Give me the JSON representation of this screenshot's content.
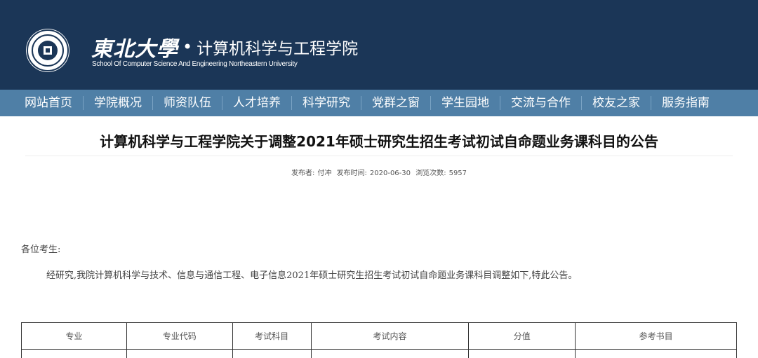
{
  "header": {
    "university": "東北大學",
    "separator": "•",
    "school_cn": "计算机科学与工程学院",
    "school_en": "School Of Computer Science And Engineering Northeastern University"
  },
  "nav": {
    "items": [
      "网站首页",
      "学院概况",
      "师资队伍",
      "人才培养",
      "科学研究",
      "党群之窗",
      "学生园地",
      "交流与合作",
      "校友之家",
      "服务指南"
    ]
  },
  "article": {
    "title": "计算机科学与工程学院关于调整2021年硕士研究生招生考试初试自命题业务课科目的公告",
    "meta": {
      "author_label": "发布者:",
      "author": "付冲",
      "date_label": "发布时间:",
      "date": "2020-06-30",
      "views_label": "浏览次数:",
      "views": "5957"
    },
    "greeting": "各位考生:",
    "paragraph": "经研究,我院计算机科学与技术、信息与通信工程、电子信息2021年硕士研究生招生考试初试自命题业务课科目调整如下,特此公告。"
  },
  "table": {
    "headers": [
      "专业",
      "专业代码",
      "考试科目",
      "考试内容",
      "分值",
      "参考书目"
    ]
  }
}
